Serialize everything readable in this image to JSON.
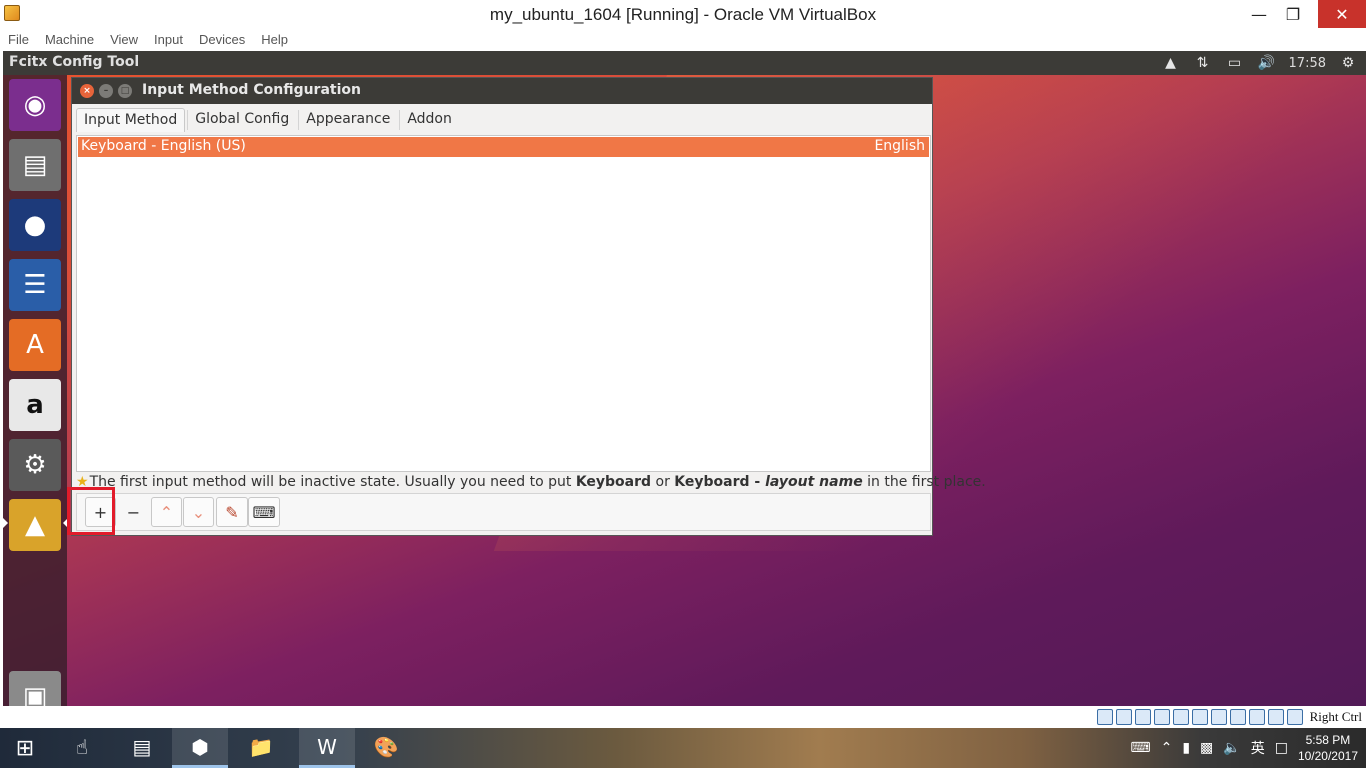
{
  "host": {
    "title": "my_ubuntu_1604 [Running] - Oracle VM VirtualBox",
    "menu": [
      "File",
      "Machine",
      "View",
      "Input",
      "Devices",
      "Help"
    ],
    "host_key": "Right Ctrl"
  },
  "guest_topbar": {
    "app_title": "Fcitx Config Tool",
    "clock": "17:58"
  },
  "dialog": {
    "title": "Input Method Configuration",
    "tabs": [
      "Input Method",
      "Global Config",
      "Appearance",
      "Addon"
    ],
    "active_tab": "Input Method",
    "list": [
      {
        "name": "Keyboard - English (US)",
        "language": "English"
      }
    ],
    "hint": {
      "part1": "The first input method will be inactive state. Usually you need to put ",
      "bold1": "Keyboard",
      "part2": " or ",
      "bold2": "Keyboard - ",
      "italic": "layout name",
      "part3": " in the first place."
    },
    "toolbar": {
      "add": "+",
      "remove": "−"
    }
  },
  "taskbar": {
    "time": "5:58 PM",
    "date": "10/20/2017",
    "ime": "英"
  },
  "colors": {
    "selection": "#f07746",
    "panel": "#3c3b37",
    "highlight_box": "#e21b2a"
  }
}
